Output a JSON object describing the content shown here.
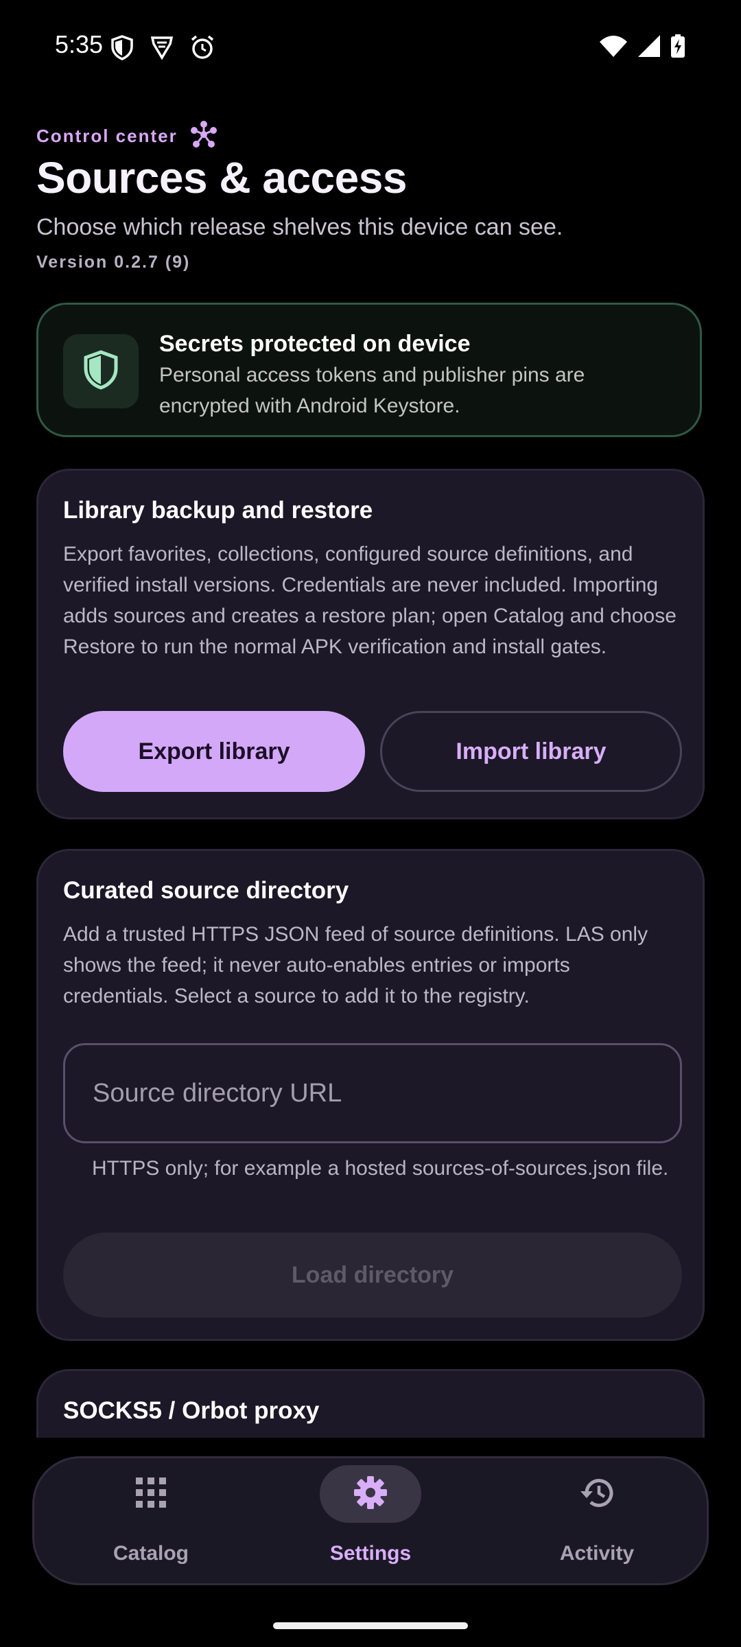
{
  "status_bar": {
    "time": "5:35",
    "icons_left": [
      "shield-icon",
      "brave-icon",
      "alarm-icon"
    ],
    "icons_right": [
      "wifi-icon",
      "signal-icon",
      "battery-charging-icon"
    ]
  },
  "header": {
    "eyebrow": "Control center",
    "title": "Sources & access",
    "subtitle": "Choose which release shelves this device can see.",
    "version": "Version 0.2.7 (9)"
  },
  "security_card": {
    "title": "Secrets protected on device",
    "body": "Personal access tokens and publisher pins are encrypted with Android Keystore."
  },
  "backup_card": {
    "title": "Library backup and restore",
    "body": "Export favorites, collections, configured source definitions, and verified install versions. Credentials are never included. Importing adds sources and creates a restore plan; open Catalog and choose Restore to run the normal APK verification and install gates.",
    "export_label": "Export library",
    "import_label": "Import library"
  },
  "directory_card": {
    "title": "Curated source directory",
    "body": "Add a trusted HTTPS JSON feed of source definitions. LAS only shows the feed; it never auto-enables entries or imports credentials. Select a source to add it to the registry.",
    "input_placeholder": "Source directory URL",
    "input_value": "",
    "helper": "HTTPS only; for example a hosted sources-of-sources.json file.",
    "load_label": "Load directory"
  },
  "proxy_card": {
    "title": "SOCKS5 / Orbot proxy"
  },
  "bottom_nav": {
    "items": [
      {
        "label": "Catalog",
        "icon": "grid-icon",
        "active": false
      },
      {
        "label": "Settings",
        "icon": "gear-icon",
        "active": true
      },
      {
        "label": "Activity",
        "icon": "history-icon",
        "active": false
      }
    ]
  },
  "colors": {
    "accent": "#d4a8f9",
    "accent_text": "#d8aef9",
    "background": "#000000",
    "card": "#1c1827",
    "secure_border": "#2f5944"
  }
}
